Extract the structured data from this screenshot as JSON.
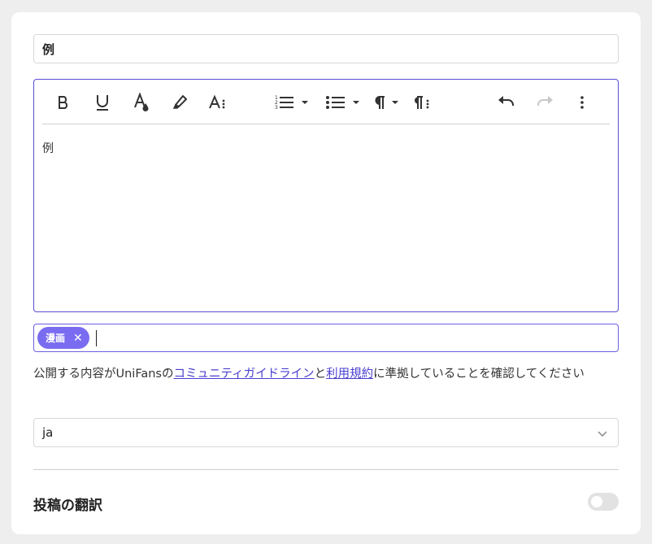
{
  "post": {
    "title_value": "例",
    "body_text": "例"
  },
  "toolbar": {
    "buttons": [
      {
        "name": "bold",
        "icon": "bold-icon"
      },
      {
        "name": "underline",
        "icon": "underline-icon"
      },
      {
        "name": "font-color",
        "icon": "font-color-icon"
      },
      {
        "name": "highlight",
        "icon": "highlighter-icon"
      },
      {
        "name": "text-size",
        "icon": "text-size-icon"
      },
      {
        "name": "numbered-list",
        "icon": "ordered-list-icon"
      },
      {
        "name": "bulleted-list",
        "icon": "bullet-list-icon"
      },
      {
        "name": "paragraph",
        "icon": "paragraph-icon"
      },
      {
        "name": "paragraph-spacing",
        "icon": "paragraph-spacing-icon"
      },
      {
        "name": "undo",
        "icon": "undo-icon"
      },
      {
        "name": "redo",
        "icon": "redo-icon",
        "disabled": true
      },
      {
        "name": "more",
        "icon": "more-vertical-icon"
      }
    ]
  },
  "tags": {
    "items": [
      {
        "label": "漫画"
      }
    ],
    "remove_symbol": "✕"
  },
  "agreement": {
    "before": "公開する内容がUniFansの",
    "link1": "コミュニティガイドライン",
    "middle": "と",
    "link2": "利用規約",
    "after": "に準拠していることを確認してください"
  },
  "language": {
    "selected": "ja"
  },
  "translation": {
    "label": "投稿の翻訳",
    "enabled": false
  },
  "colors": {
    "accent": "#5a4dd6",
    "tag_bg": "#7a6cf0",
    "link": "#4a3fd0",
    "toggle_off": "#e2e2e2"
  }
}
